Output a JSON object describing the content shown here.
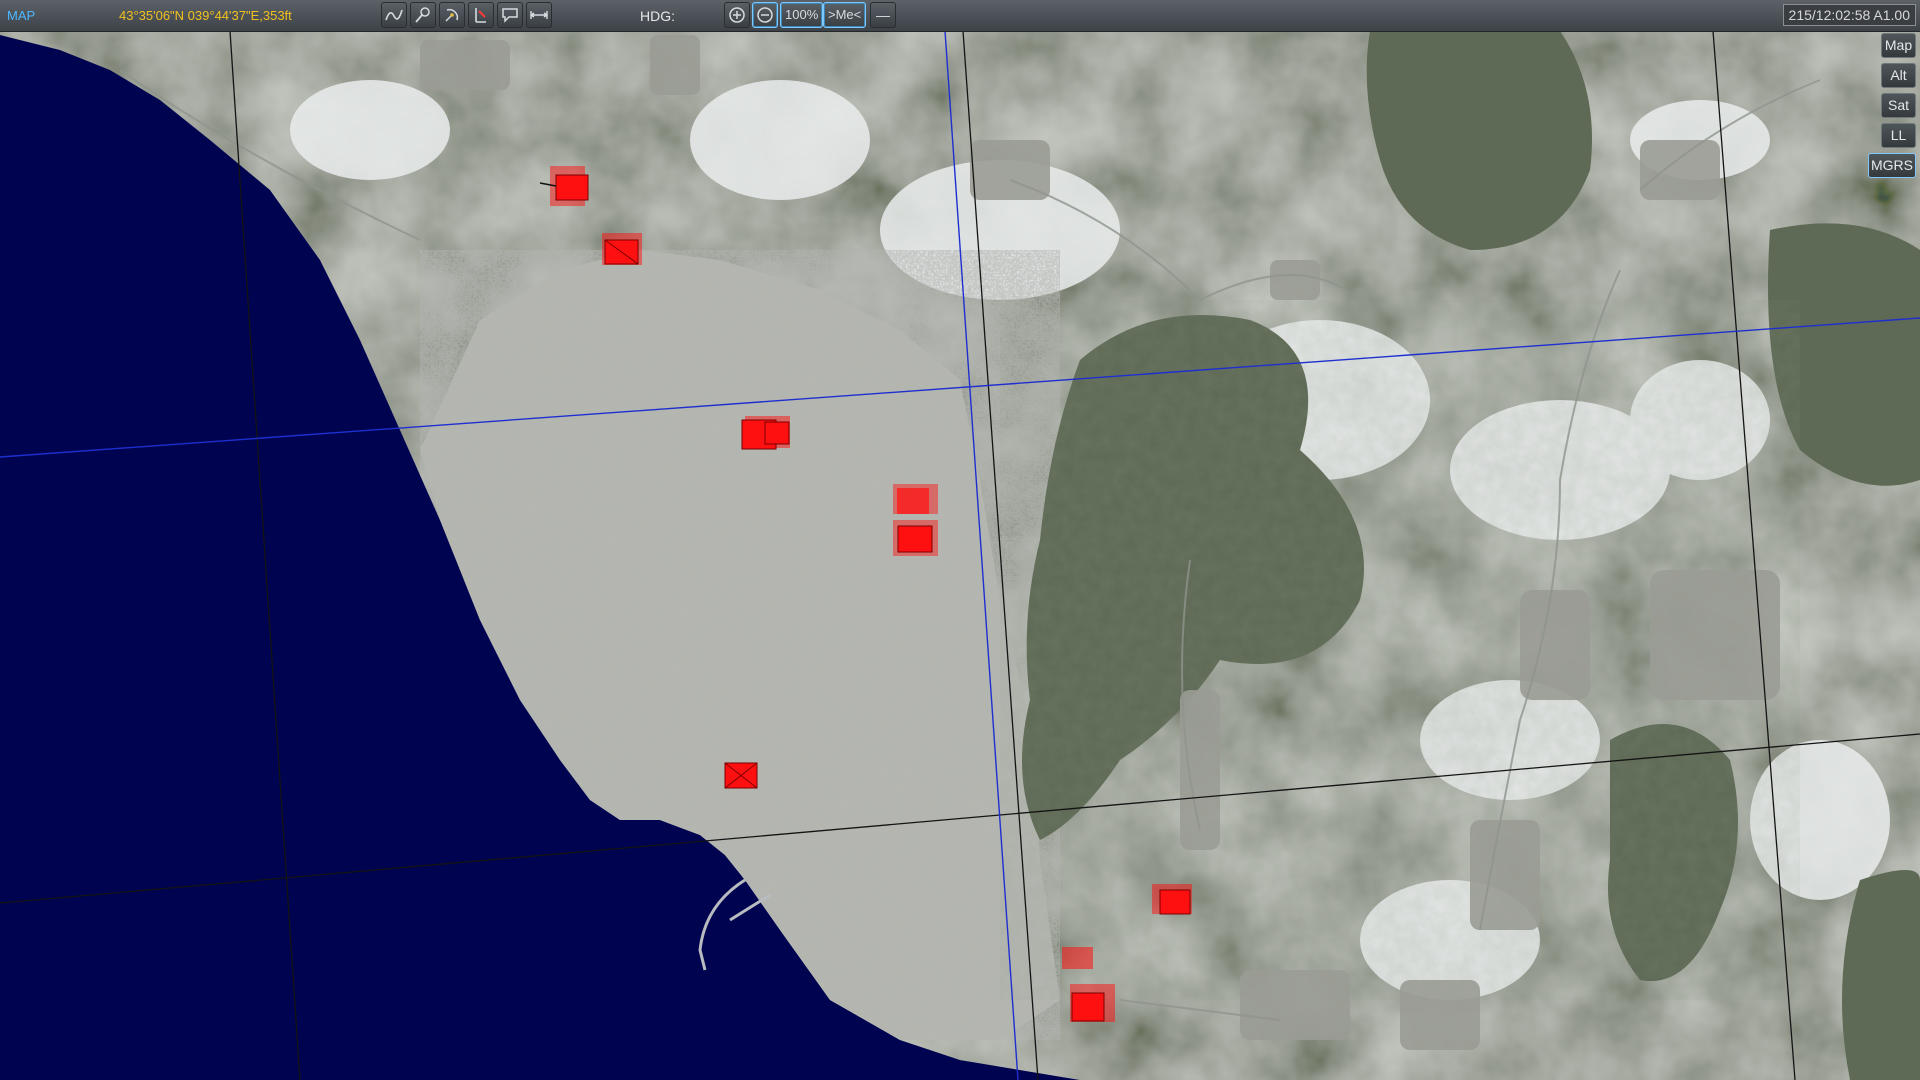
{
  "toolbar": {
    "mode_label": "MAP",
    "coordinates": "43°35'06\"N 039°44'37\"E,353ft",
    "heading_label": "HDG:",
    "zoom_level": "100%",
    "center_on_me_label": ">Me<",
    "ruler_label": "—",
    "datetime": "215/12:02:58 A1.00",
    "icons": [
      "route-tool-icon",
      "measure-tool-icon",
      "radar-tool-icon",
      "weapon-tool-icon",
      "comment-tool-icon",
      "distance-tool-icon",
      "zoom-in-icon",
      "zoom-out-icon"
    ]
  },
  "side_buttons": {
    "map": "Map",
    "alt": "Alt",
    "sat": "Sat",
    "ll": "LL",
    "mgrs": "MGRS"
  },
  "colors": {
    "sea": "#00034f",
    "unit_marker": "#ff1010",
    "grid_blue": "#1e2fd0",
    "grid_black": "#141414",
    "coords_text": "#f0c020",
    "accent": "#4db8ff"
  }
}
